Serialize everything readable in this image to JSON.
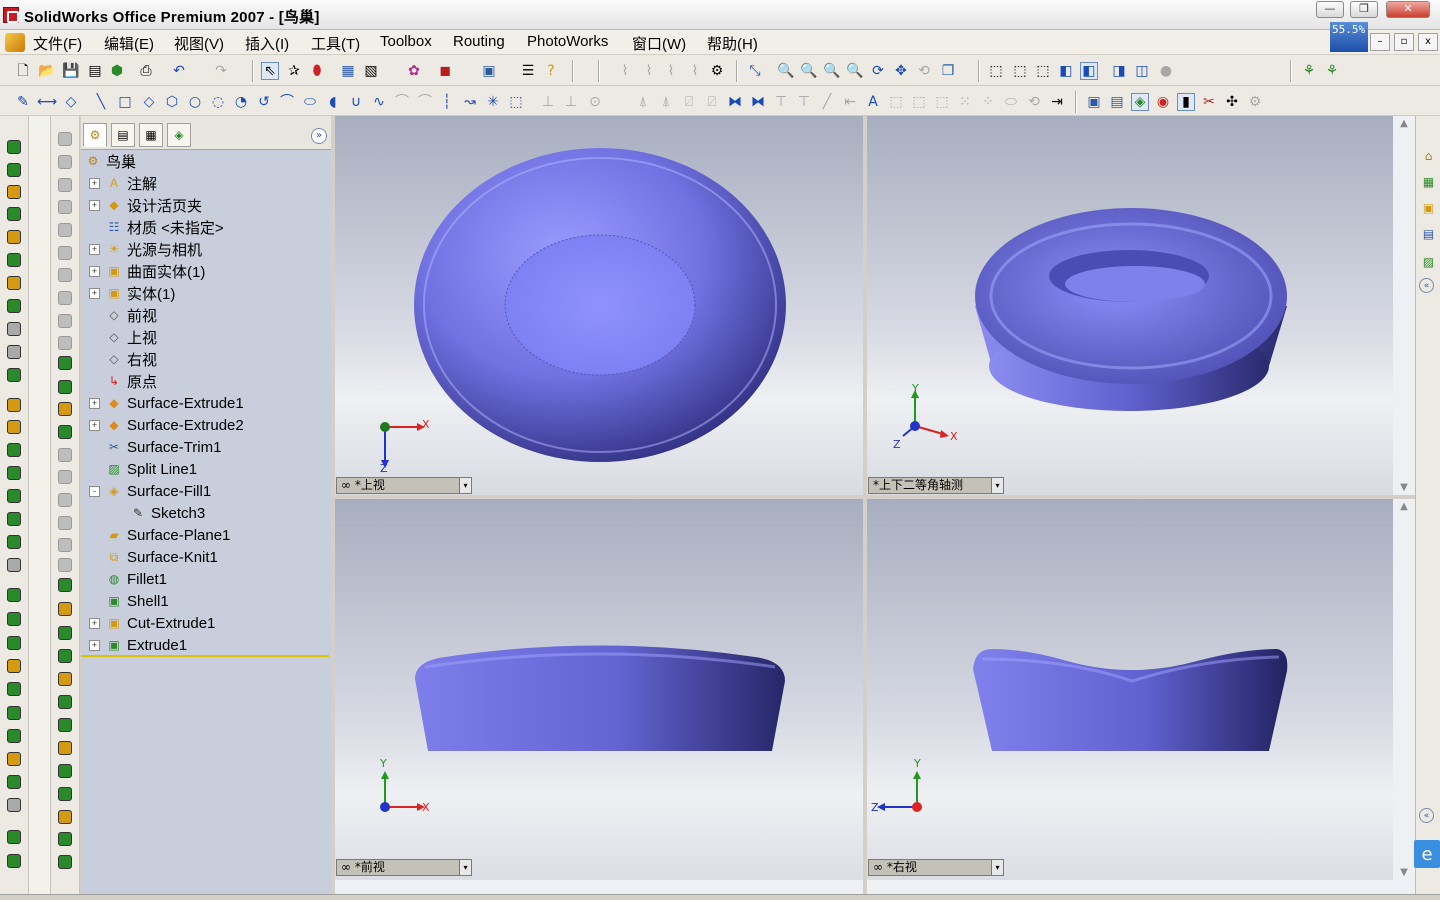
{
  "window": {
    "title": "SolidWorks Office Premium 2007 - [鸟巢]",
    "minimize_label": "—",
    "restore_label": "❐",
    "close_label": "✕",
    "zoom_badge": "55.5%"
  },
  "menu": {
    "items": [
      "文件(F)",
      "编辑(E)",
      "视图(V)",
      "插入(I)",
      "工具(T)",
      "Toolbox",
      "Routing",
      "PhotoWorks",
      "窗口(W)",
      "帮助(H)"
    ],
    "mdi_minimize": "–",
    "mdi_restore": "▫",
    "mdi_close": "x"
  },
  "tree": {
    "root": "鸟巢",
    "items": [
      {
        "label": "注解",
        "expand": "+",
        "icon": "annotation-icon"
      },
      {
        "label": "设计活页夹",
        "expand": "+",
        "icon": "design-binder-icon"
      },
      {
        "label": "材质 <未指定>",
        "expand": "",
        "icon": "material-icon"
      },
      {
        "label": "光源与相机",
        "expand": "+",
        "icon": "lights-cameras-icon"
      },
      {
        "label": "曲面实体(1)",
        "expand": "+",
        "icon": "surface-bodies-icon"
      },
      {
        "label": "实体(1)",
        "expand": "+",
        "icon": "solid-bodies-icon"
      },
      {
        "label": "前视",
        "expand": "",
        "icon": "plane-icon"
      },
      {
        "label": "上视",
        "expand": "",
        "icon": "plane-icon"
      },
      {
        "label": "右视",
        "expand": "",
        "icon": "plane-icon"
      },
      {
        "label": "原点",
        "expand": "",
        "icon": "origin-icon"
      },
      {
        "label": "Surface-Extrude1",
        "expand": "+",
        "icon": "surface-extrude-icon"
      },
      {
        "label": "Surface-Extrude2",
        "expand": "+",
        "icon": "surface-extrude-icon"
      },
      {
        "label": "Surface-Trim1",
        "expand": "",
        "icon": "surface-trim-icon"
      },
      {
        "label": "Split Line1",
        "expand": "",
        "icon": "split-line-icon"
      },
      {
        "label": "Surface-Fill1",
        "expand": "-",
        "icon": "surface-fill-icon"
      },
      {
        "label": "Sketch3",
        "expand": "",
        "icon": "sketch-icon",
        "indent": true
      },
      {
        "label": "Surface-Plane1",
        "expand": "",
        "icon": "surface-plane-icon"
      },
      {
        "label": "Surface-Knit1",
        "expand": "",
        "icon": "surface-knit-icon"
      },
      {
        "label": "Fillet1",
        "expand": "",
        "icon": "fillet-icon"
      },
      {
        "label": "Shell1",
        "expand": "",
        "icon": "shell-icon"
      },
      {
        "label": "Cut-Extrude1",
        "expand": "+",
        "icon": "cut-extrude-icon"
      },
      {
        "label": "Extrude1",
        "expand": "+",
        "icon": "extrude-icon"
      }
    ],
    "collapse_label": "»"
  },
  "viewports": {
    "top": "*上视",
    "iso": "*上下二等角轴测",
    "front": "*前视",
    "right": "*右视",
    "dropdown": "▾",
    "link_icon": "∞"
  },
  "axes": {
    "x": "X",
    "y": "Y",
    "z": "Z"
  },
  "colors": {
    "model": "#6d6ee0",
    "background_top": "#a8aec0",
    "background_mid": "#eef0f3",
    "tree_bg": "#c8cedb",
    "tree_end_line": "#d9c300"
  }
}
